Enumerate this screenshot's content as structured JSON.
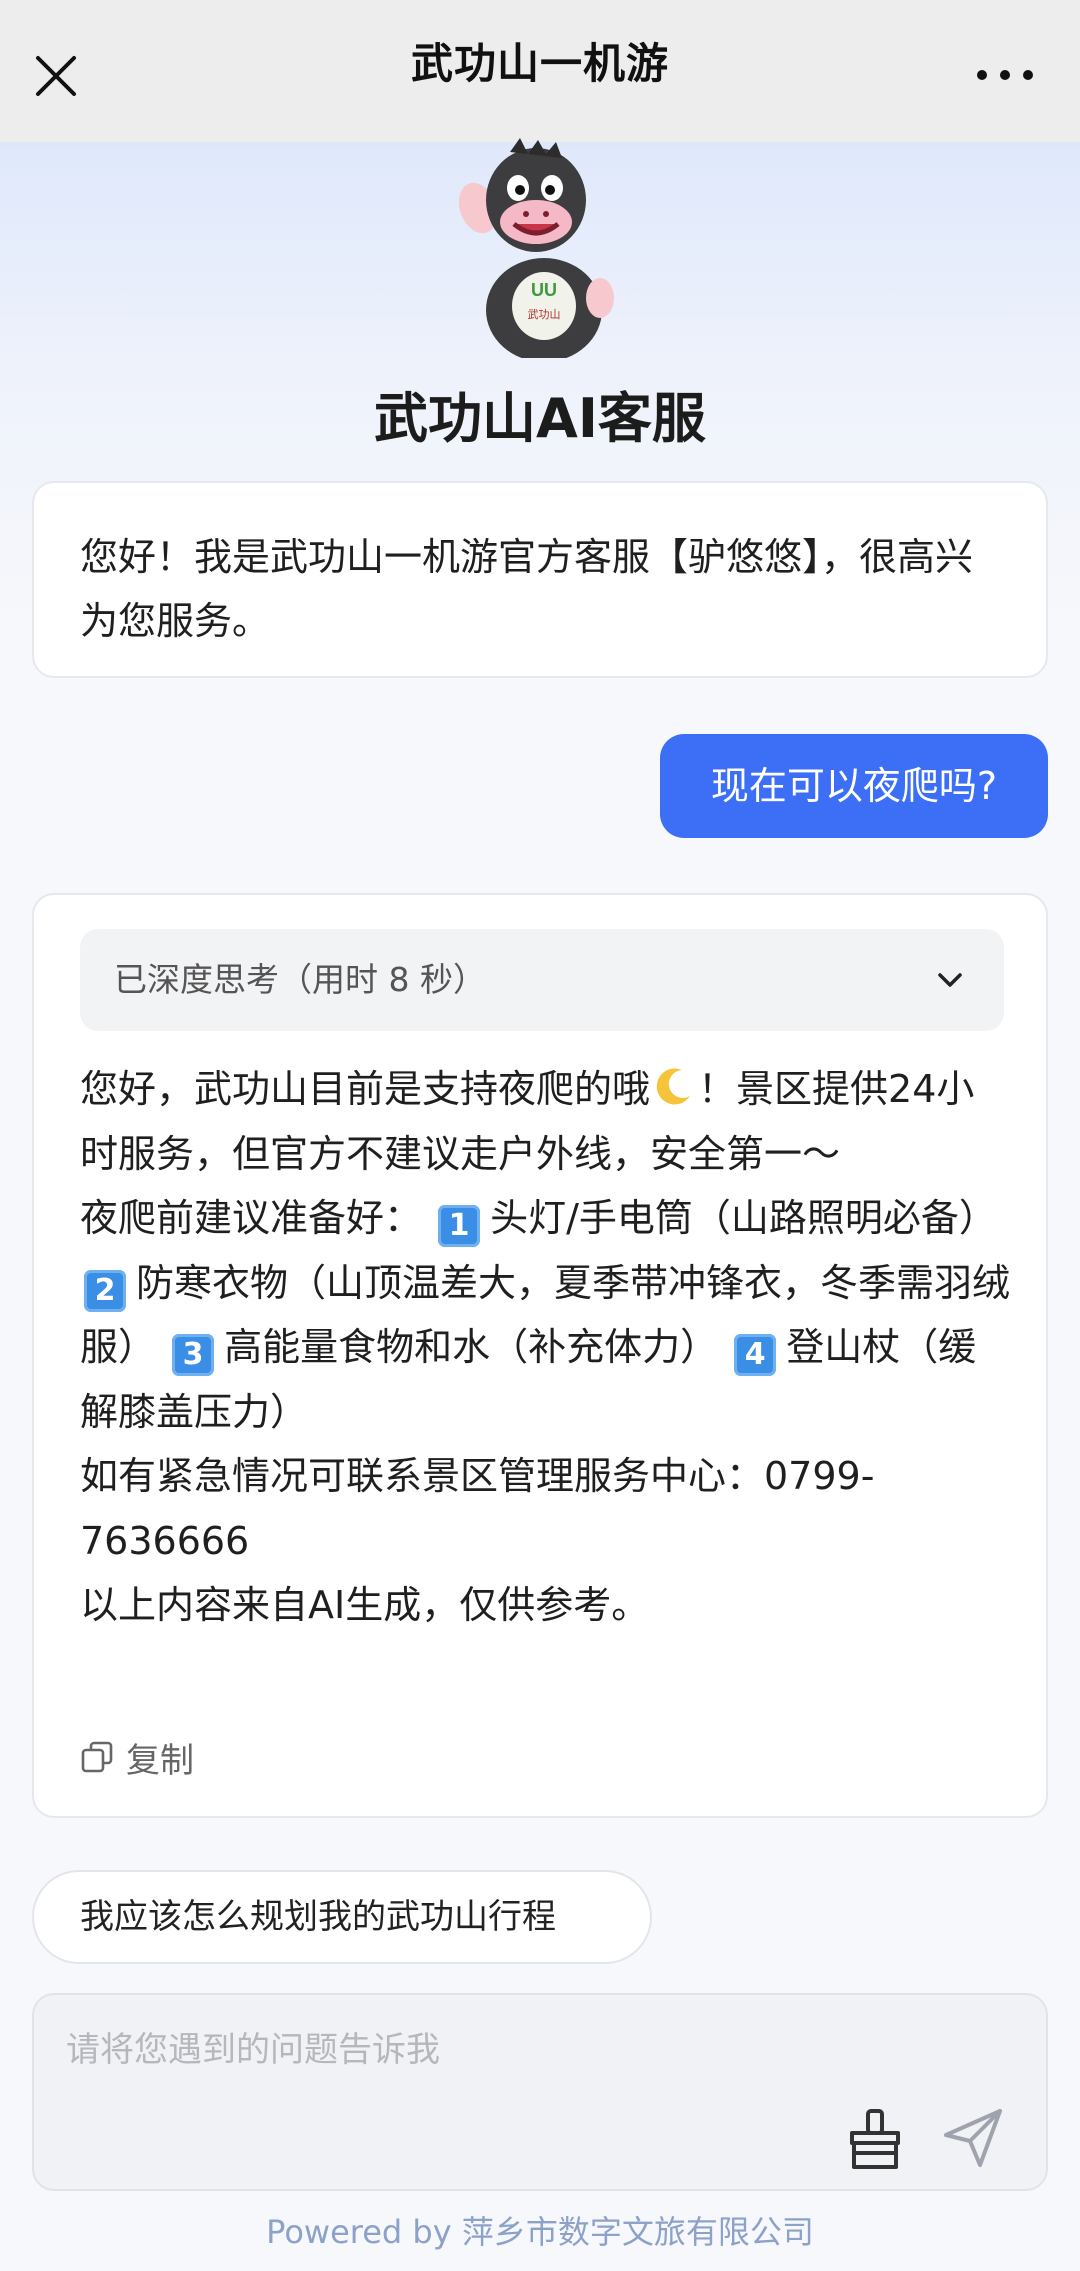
{
  "window": {
    "title": "武功山一机游",
    "close_icon": "close-icon",
    "more_icon": "more-dots-icon"
  },
  "header": {
    "bot_name": "武功山AI客服",
    "mascot_badge_text": "UU",
    "mascot_badge_sub": "武功山"
  },
  "chat": {
    "greeting": "您好！我是武功山一机游官方客服【驴悠悠】，很高兴为您服务。",
    "user_message": "现在可以夜爬吗?",
    "reply": {
      "thinking_label": "已深度思考（用时 8 秒）",
      "line1_part1": "您好，武功山目前是支持夜爬的哦",
      "line1_part2": "！景区提供24小时服务，但官方不建议走户外线，安全第一～",
      "prep_intro": "夜爬前建议准备好：",
      "items": [
        {
          "num": "1",
          "text": "头灯/手电筒（山路照明必备）"
        },
        {
          "num": "2",
          "text": "防寒衣物（山顶温差大，夏季带冲锋衣，冬季需羽绒服）"
        },
        {
          "num": "3",
          "text": "高能量食物和水（补充体力）"
        },
        {
          "num": "4",
          "text": "登山杖（缓解膝盖压力）"
        }
      ],
      "contact_line": "如有紧急情况可联系景区管理服务中心：0799-7636666",
      "disclaimer": "以上内容来自AI生成，仅供参考。",
      "copy_label": "复制"
    },
    "suggestion": "我应该怎么规划我的武功山行程"
  },
  "input": {
    "placeholder": "请将您遇到的问题告诉我",
    "value": ""
  },
  "footer": {
    "text": "Powered by 萍乡市数字文旅有限公司"
  },
  "colors": {
    "accent": "#3c6ff6",
    "topbar_bg": "#ededed",
    "footer_text": "#8da2c9"
  }
}
